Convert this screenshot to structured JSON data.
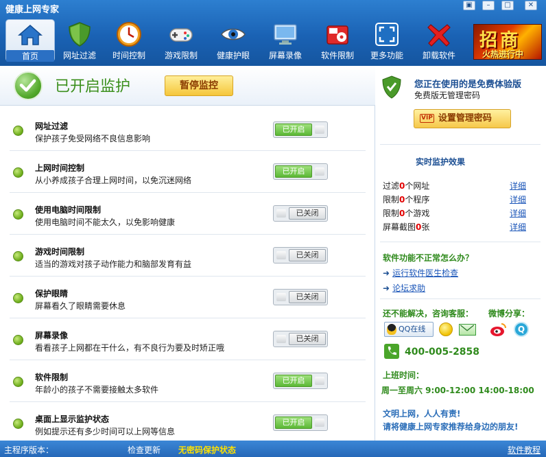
{
  "window": {
    "title": "健康上网专家",
    "controls": [
      "▣",
      "–",
      "□",
      "✕"
    ]
  },
  "toolbar": {
    "items": [
      {
        "label": "首页",
        "icon": "home-icon",
        "active": true
      },
      {
        "label": "网址过滤",
        "icon": "shield-icon"
      },
      {
        "label": "时间控制",
        "icon": "clock-icon"
      },
      {
        "label": "游戏限制",
        "icon": "gamepad-icon"
      },
      {
        "label": "健康护眼",
        "icon": "eye-icon"
      },
      {
        "label": "屏幕录像",
        "icon": "monitor-icon"
      },
      {
        "label": "软件限制",
        "icon": "disc-icon"
      },
      {
        "label": "更多功能",
        "icon": "expand-icon"
      },
      {
        "label": "卸载软件",
        "icon": "red-x-icon"
      }
    ],
    "promo": {
      "big": "招商",
      "small": "火热进行中"
    }
  },
  "status": {
    "text": "已开启监护",
    "pause_label": "暂停监控"
  },
  "features": [
    {
      "title": "网址过滤",
      "desc": "保护孩子免受网络不良信息影响",
      "toggle": "已开启",
      "on": true
    },
    {
      "title": "上网时间控制",
      "desc": "从小养成孩子合理上网时间，以免沉迷网络",
      "toggle": "已开启",
      "on": true
    },
    {
      "title": "使用电脑时间限制",
      "desc": "使用电脑时间不能太久，以免影响健康",
      "toggle": "已关闭",
      "on": false
    },
    {
      "title": "游戏时间限制",
      "desc": "适当的游戏对孩子动作能力和脑部发育有益",
      "toggle": "已关闭",
      "on": false
    },
    {
      "title": "保护眼睛",
      "desc": "屏幕看久了眼睛需要休息",
      "toggle": "已关闭",
      "on": false
    },
    {
      "title": "屏幕录像",
      "desc": "看看孩子上网都在干什么，有不良行为要及时矫正哦",
      "toggle": "已关闭",
      "on": false
    },
    {
      "title": "软件限制",
      "desc": "年龄小的孩子不需要接触太多软件",
      "toggle": "已开启",
      "on": true
    },
    {
      "title": "桌面上显示监护状态",
      "desc": "例如提示还有多少时间可以上网等信息",
      "toggle": "已开启",
      "on": true
    }
  ],
  "side": {
    "free_title": "您正在使用的是免费体验版",
    "free_sub": "免费版无管理密码",
    "vip_tag": "VIP",
    "pwd_button": "设置管理密码",
    "monitor_title": "实时监护效果",
    "monitor_rows": [
      {
        "pre": "过滤",
        "num": "0",
        "post": "个网址",
        "detail": "详细"
      },
      {
        "pre": "限制",
        "num": "0",
        "post": "个程序",
        "detail": "详细"
      },
      {
        "pre": "限制",
        "num": "0",
        "post": "个游戏",
        "detail": "详细"
      },
      {
        "pre": "屏幕截图",
        "num": "0",
        "post": "张",
        "detail": "详细"
      }
    ],
    "question": "软件功能不正常怎么办？",
    "links": [
      "运行软件医生检查",
      "论坛求助"
    ],
    "cs_title": "还不能解决，咨询客服：",
    "weibo_title": "微博分享：",
    "qq_label": "QQ在线",
    "tqq_glyph": "Q",
    "phone": "400-005-2858",
    "work_title": "上班时间：",
    "work_time": "周一至周六 9:00-12:00 14:00-18:00",
    "slogan1": "文明上网，人人有责!",
    "slogan2": "请将健康上网专家推荐给身边的朋友!"
  },
  "statusbar": {
    "version": "主程序版本：",
    "update": "检查更新",
    "nopwd": "无密码保护状态",
    "tutorial": "软件教程"
  }
}
